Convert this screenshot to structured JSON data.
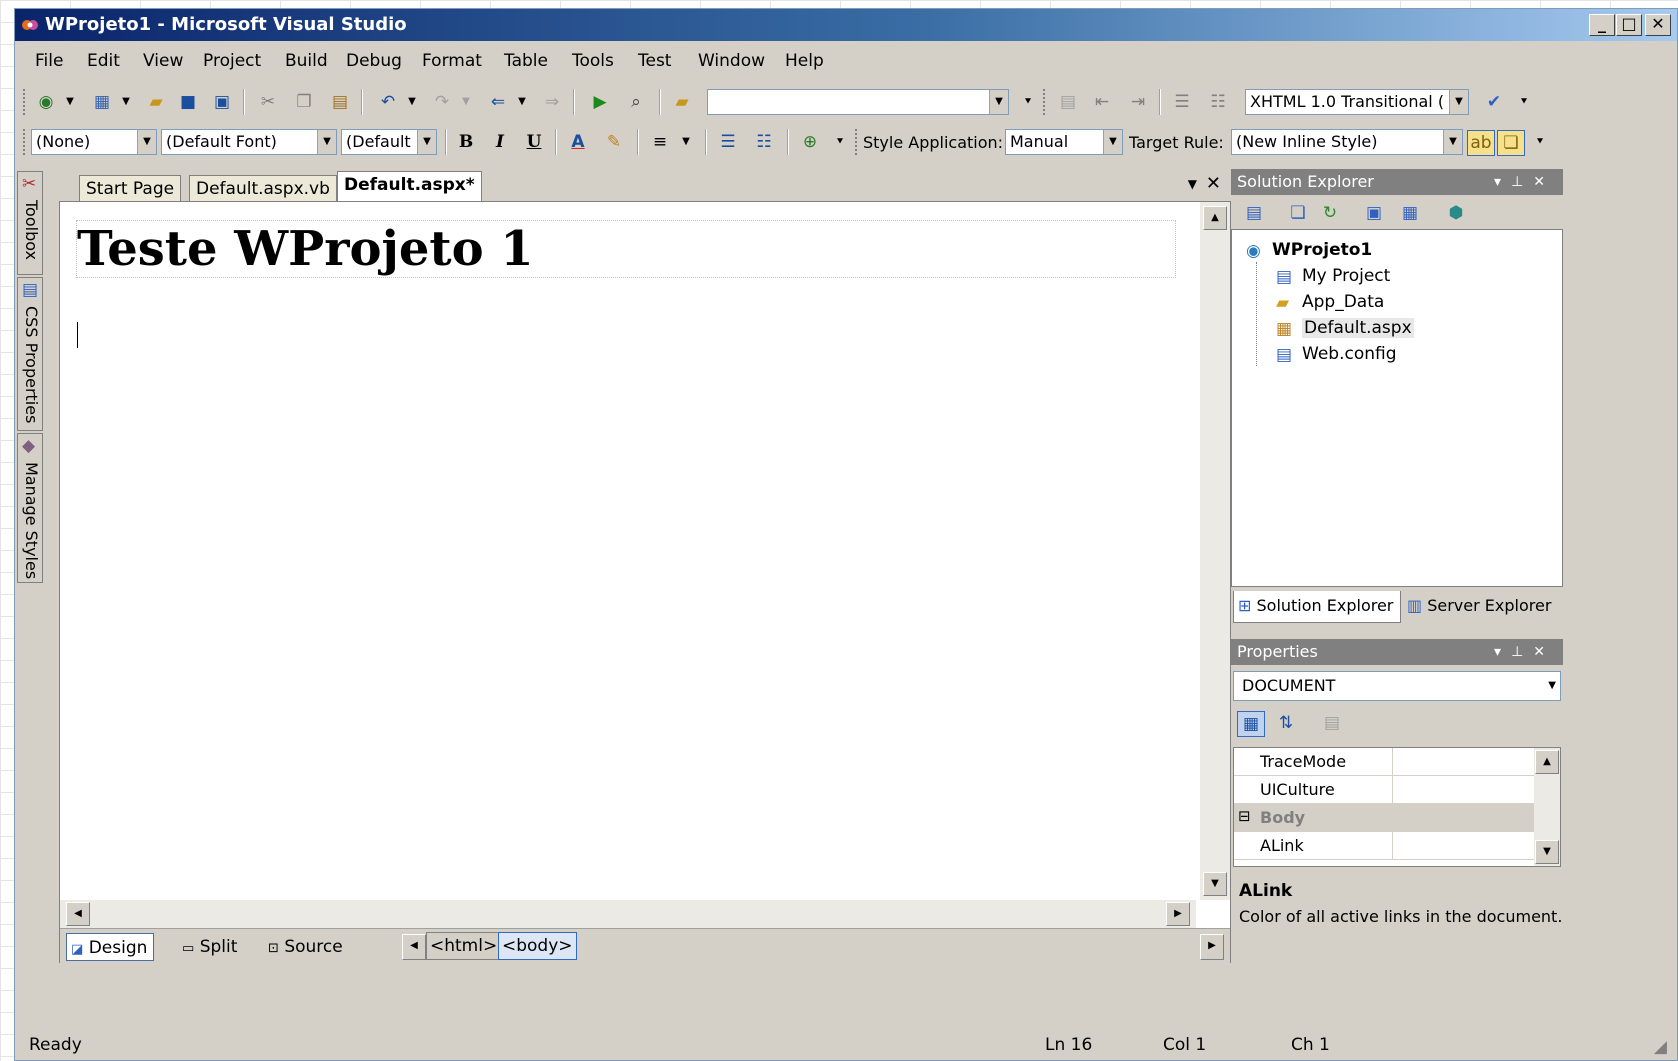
{
  "window": {
    "title": "WProjeto1 - Microsoft Visual Studio",
    "min": "_",
    "max": "□",
    "close": "✕"
  },
  "menu": [
    "File",
    "Edit",
    "View",
    "Project",
    "Build",
    "Debug",
    "Format",
    "Table",
    "Tools",
    "Test",
    "Window",
    "Help"
  ],
  "toolbar1": {
    "schema_combo": "XHTML 1.0 Transitional (",
    "search_combo": ""
  },
  "toolbar2": {
    "block_format": "(None)",
    "font_name": "(Default Font)",
    "font_size": "(Default",
    "bold": "B",
    "italic": "I",
    "underline": "U",
    "style_app_label": "Style Application:",
    "style_app_value": "Manual",
    "target_rule_label": "Target Rule:",
    "target_rule_value": "(New Inline Style)"
  },
  "leftdock": [
    "Toolbox",
    "CSS Properties",
    "Manage Styles"
  ],
  "doctabs": [
    "Start Page",
    "Default.aspx.vb",
    "Default.aspx*"
  ],
  "editor": {
    "heading": "Teste WProjeto 1"
  },
  "viewbar": {
    "design": "Design",
    "split": "Split",
    "source": "Source",
    "tags": [
      "<html>",
      "<body>"
    ]
  },
  "solution_explorer": {
    "title": "Solution Explorer",
    "project": "WProjeto1",
    "items": [
      "My Project",
      "App_Data",
      "Default.aspx",
      "Web.config"
    ],
    "bottom_tabs": [
      "Solution Explorer",
      "Server Explorer"
    ]
  },
  "properties": {
    "title": "Properties",
    "object": "DOCUMENT",
    "rows": [
      {
        "name": "TraceMode",
        "type": "prop"
      },
      {
        "name": "UICulture",
        "type": "prop"
      },
      {
        "name": "Body",
        "type": "category"
      },
      {
        "name": "ALink",
        "type": "prop"
      }
    ],
    "desc_title": "ALink",
    "desc_text": "Color of all active links in the document."
  },
  "status": {
    "text": "Ready",
    "ln": "Ln 16",
    "col": "Col 1",
    "ch": "Ch 1"
  },
  "colors": {
    "title_start": "#0a246a",
    "title_end": "#a6caf0",
    "chrome": "#d4d0c8",
    "panel_title": "#808080"
  }
}
